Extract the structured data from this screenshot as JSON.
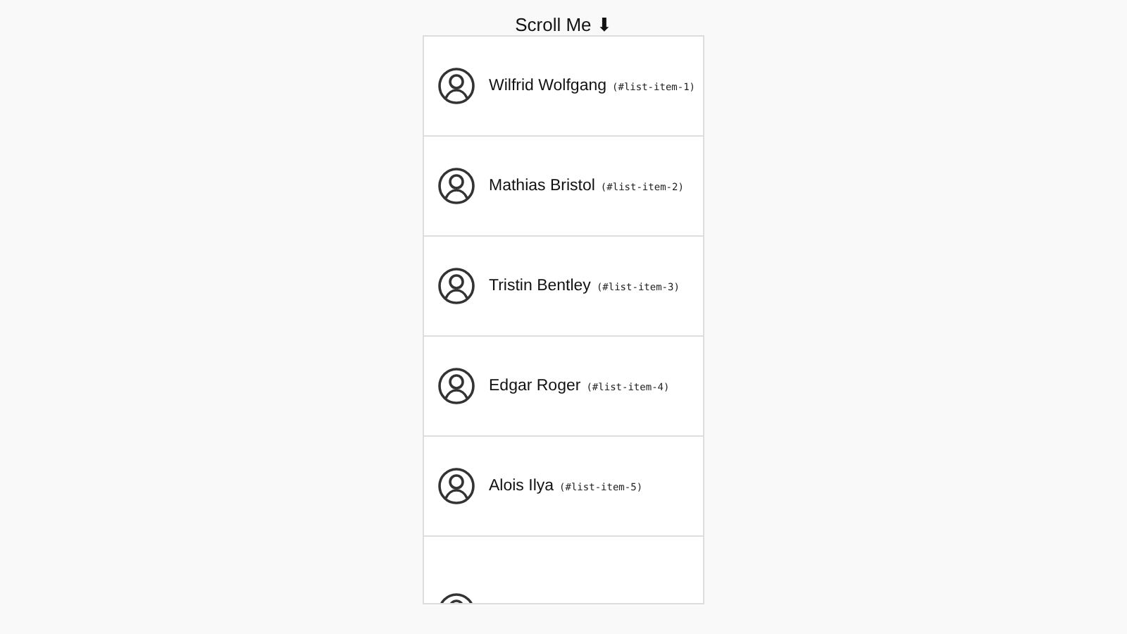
{
  "title": "Scroll Me ⬇",
  "items": [
    {
      "name": "Wilfrid Wolfgang",
      "id_label": "(#list-item-1)",
      "kind": "normal"
    },
    {
      "name": "Mathias Bristol",
      "id_label": "(#list-item-2)",
      "kind": "normal"
    },
    {
      "name": "Tristin Bentley",
      "id_label": "(#list-item-3)",
      "kind": "normal"
    },
    {
      "name": "Edgar Roger",
      "id_label": "(#list-item-4)",
      "kind": "normal"
    },
    {
      "name": "Alois Ilya",
      "id_label": "(#list-item-5)",
      "kind": "normal"
    },
    {
      "kind": "tall"
    }
  ]
}
